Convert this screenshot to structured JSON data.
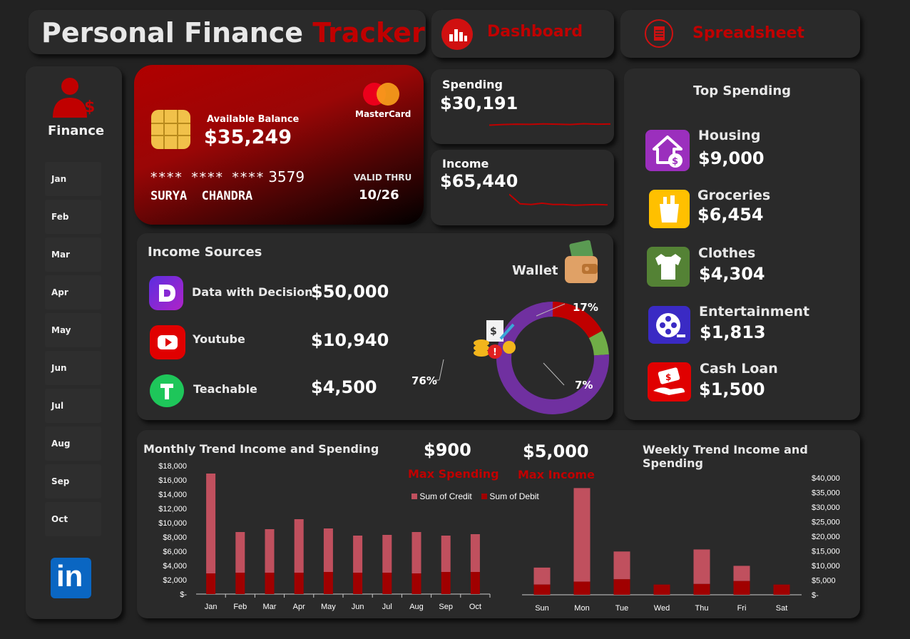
{
  "title": {
    "part1": "Personal Finance",
    "part2": "Tracker"
  },
  "nav": {
    "dashboard": "Dashboard",
    "spreadsheet": "Spreadsheet"
  },
  "sidebar": {
    "label": "Finance",
    "months": [
      "Jan",
      "Feb",
      "Mar",
      "Apr",
      "May",
      "Jun",
      "Jul",
      "Aug",
      "Sep",
      "Oct"
    ],
    "linkedin": "in"
  },
  "card": {
    "balance_label": "Available Balance",
    "balance": "$35,249",
    "brand": "MasterCard",
    "number_mask": "**** **** ****",
    "number_last": "3579",
    "holder": "SURYA  CHANDRA",
    "valid_label": "VALID THRU",
    "valid": "10/26"
  },
  "spending": {
    "label": "Spending",
    "value": "$30,191"
  },
  "income": {
    "label": "Income",
    "value": "$65,440"
  },
  "income_sources": {
    "title": "Income Sources",
    "items": [
      {
        "name": "Data with Decision",
        "value": "$50,000"
      },
      {
        "name": "Youtube",
        "value": "$10,940"
      },
      {
        "name": "Teachable",
        "value": "$4,500"
      }
    ]
  },
  "wallet": {
    "label": "Wallet",
    "pct_17": "17%",
    "pct_7": "7%",
    "pct_76": "76%"
  },
  "top_spending": {
    "title": "Top Spending",
    "items": [
      {
        "name": "Housing",
        "value": "$9,000"
      },
      {
        "name": "Groceries",
        "value": "$6,454"
      },
      {
        "name": "Clothes",
        "value": "$4,304"
      },
      {
        "name": "Entertainment",
        "value": "$1,813"
      },
      {
        "name": "Cash Loan",
        "value": "$1,500"
      }
    ]
  },
  "kpis": {
    "max_spending_value": "$900",
    "max_spending_label": "Max Spending",
    "max_income_value": "$5,000",
    "max_income_label": "Max Income"
  },
  "colors": {
    "accent": "#c00000",
    "credit": "#c0505e",
    "debit": "#a00000",
    "purple": "#7030a0",
    "green": "#70ad47"
  },
  "chart_data": [
    {
      "type": "bar",
      "title": "Monthly Trend Income and Spending",
      "categories": [
        "Jan",
        "Feb",
        "Mar",
        "Apr",
        "May",
        "Jun",
        "Jul",
        "Aug",
        "Sep",
        "Oct"
      ],
      "series": [
        {
          "name": "Sum of Credit",
          "values": [
            14000,
            5700,
            6100,
            7500,
            6100,
            5200,
            5300,
            5800,
            5100,
            5300
          ]
        },
        {
          "name": "Sum of Debit",
          "values": [
            2900,
            3000,
            3000,
            3000,
            3100,
            3000,
            3000,
            2900,
            3100,
            3100
          ]
        }
      ],
      "ylim": [
        0,
        18000
      ],
      "yticks": [
        "$-",
        "$2,000",
        "$4,000",
        "$6,000",
        "$8,000",
        "$10,000",
        "$12,000",
        "$14,000",
        "$16,000",
        "$18,000"
      ]
    },
    {
      "type": "bar",
      "title": "Weekly Trend Income and Spending",
      "categories": [
        "Sun",
        "Mon",
        "Tue",
        "Wed",
        "Thu",
        "Fri",
        "Sat"
      ],
      "series": [
        {
          "name": "Sum of Credit",
          "values": [
            5800,
            32000,
            9500,
            0,
            11800,
            5200,
            0
          ]
        },
        {
          "name": "Sum of Debit",
          "values": [
            3500,
            4500,
            5300,
            3500,
            3700,
            4700,
            3500
          ]
        }
      ],
      "ylim": [
        0,
        40000
      ],
      "yticks": [
        "$-",
        "$5,000",
        "$10,000",
        "$15,000",
        "$20,000",
        "$25,000",
        "$30,000",
        "$35,000",
        "$40,000"
      ]
    },
    {
      "type": "pie",
      "title": "",
      "labels": [
        "Data with Decision",
        "Youtube",
        "Teachable"
      ],
      "values": [
        76,
        17,
        7
      ]
    },
    {
      "type": "line",
      "title": "Spending",
      "values": [
        3.0,
        3.2,
        3.3,
        3.25,
        3.4,
        3.3,
        3.2,
        3.45,
        3.3,
        3.35
      ]
    },
    {
      "type": "line",
      "title": "Income",
      "values": [
        6.5,
        5.1,
        5.0,
        5.2,
        5.0,
        5.0,
        4.9,
        4.95,
        5.0,
        4.95
      ]
    }
  ]
}
